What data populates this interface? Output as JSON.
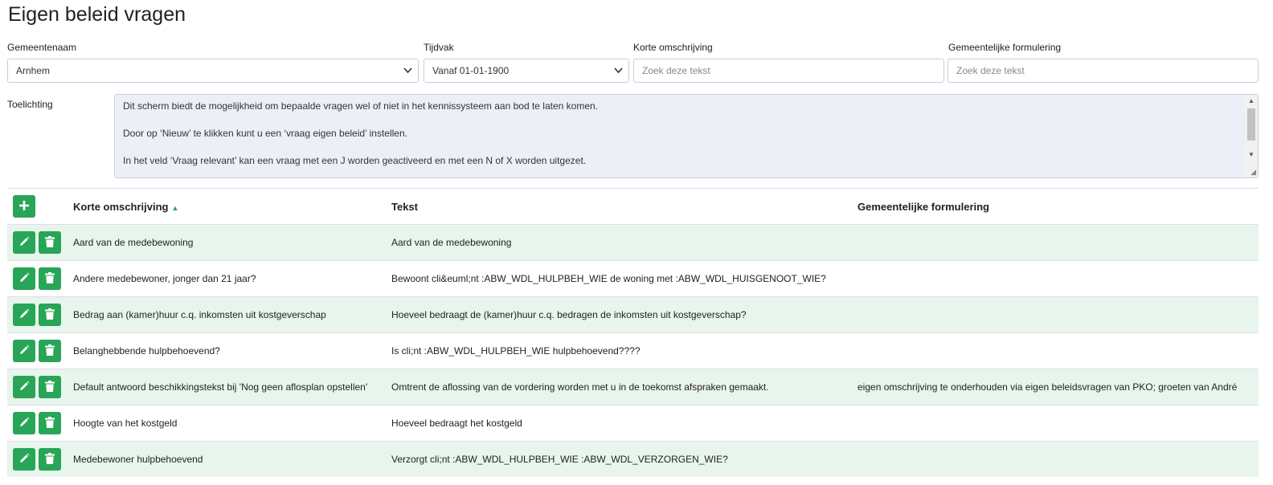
{
  "page_title": "Eigen beleid vragen",
  "filters": {
    "gemeentenaam": {
      "label": "Gemeentenaam",
      "value": "Arnhem"
    },
    "tijdvak": {
      "label": "Tijdvak",
      "value": "Vanaf 01-01-1900"
    },
    "korte_omschrijving": {
      "label": "Korte omschrijving",
      "placeholder": "Zoek deze tekst"
    },
    "gemeentelijke_formulering": {
      "label": "Gemeentelijke formulering",
      "placeholder": "Zoek deze tekst"
    }
  },
  "toelichting": {
    "label": "Toelichting",
    "paragraphs": [
      "Dit scherm biedt de mogelijkheid om bepaalde vragen wel of niet in het kennissysteem aan bod te laten komen.",
      "Door op ‘Nieuw’ te klikken kunt u een ‘vraag eigen beleid’ instellen.",
      "In het veld ‘Vraag relevant’ kan een vraag met een J worden geactiveerd en met een N of X worden uitgezet."
    ]
  },
  "table": {
    "headers": {
      "korte_omschrijving": "Korte omschrijving",
      "tekst": "Tekst",
      "gemeentelijke_formulering": "Gemeentelijke formulering"
    },
    "sort_indicator": "▲",
    "rows": [
      {
        "korte": "Aard van de medebewoning",
        "tekst": "Aard van de medebewoning",
        "formulering": ""
      },
      {
        "korte": "Andere medebewoner, jonger dan 21 jaar?",
        "tekst": "Bewoont cli&euml;nt :ABW_WDL_HULPBEH_WIE de woning met :ABW_WDL_HUISGENOOT_WIE?",
        "formulering": ""
      },
      {
        "korte": "Bedrag aan (kamer)huur c.q. inkomsten uit kostgeverschap",
        "tekst": "Hoeveel bedraagt de (kamer)huur c.q. bedragen de inkomsten uit kostgeverschap?",
        "formulering": ""
      },
      {
        "korte": "Belanghebbende hulpbehoevend?",
        "tekst": "Is cli;nt :ABW_WDL_HULPBEH_WIE hulpbehoevend????",
        "formulering": ""
      },
      {
        "korte": "Default antwoord beschikkingstekst bij 'Nog geen aflosplan opstellen'",
        "tekst": "Omtrent de aflossing van de vordering worden met u in de toekomst afspraken gemaakt.",
        "formulering": "eigen omschrijving te onderhouden via eigen beleidsvragen van PKO; groeten van André"
      },
      {
        "korte": "Hoogte van het kostgeld",
        "tekst": "Hoeveel bedraagt het kostgeld",
        "formulering": ""
      },
      {
        "korte": "Medebewoner hulpbehoevend",
        "tekst": "Verzorgt cli;nt :ABW_WDL_HULPBEH_WIE :ABW_WDL_VERZORGEN_WIE?",
        "formulering": ""
      }
    ]
  },
  "icons": {
    "add": "plus-icon",
    "edit": "pencil-icon",
    "delete": "trash-icon",
    "dropdown": "chevron-down-icon"
  },
  "colors": {
    "accent": "#28a557",
    "row_highlight": "#e8f5ec",
    "textarea_bg": "#eceff5"
  }
}
